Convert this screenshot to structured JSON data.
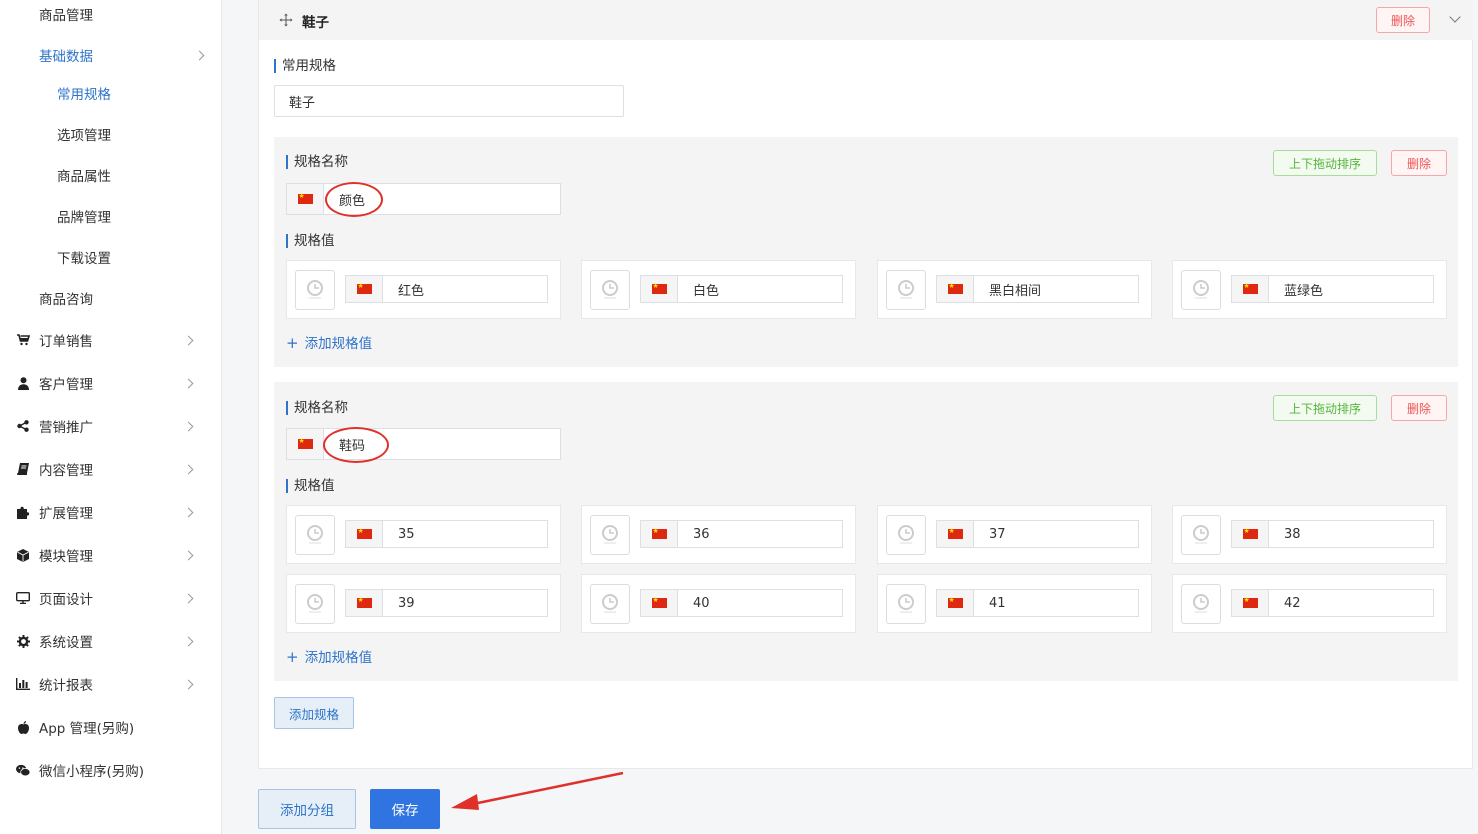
{
  "sidebar": {
    "items": [
      {
        "label": "商品管理",
        "level": "sub1",
        "icon": "",
        "chevron": false
      },
      {
        "label": "基础数据",
        "level": "sub1",
        "icon": "",
        "chevron": true,
        "state": "active-parent"
      },
      {
        "label": "常用规格",
        "level": "sub2",
        "icon": "",
        "chevron": false,
        "state": "active"
      },
      {
        "label": "选项管理",
        "level": "sub2",
        "icon": "",
        "chevron": false
      },
      {
        "label": "商品属性",
        "level": "sub2",
        "icon": "",
        "chevron": false
      },
      {
        "label": "品牌管理",
        "level": "sub2",
        "icon": "",
        "chevron": false
      },
      {
        "label": "下载设置",
        "level": "sub2",
        "icon": "",
        "chevron": false
      },
      {
        "label": "商品咨询",
        "level": "sub1",
        "icon": "",
        "chevron": false
      },
      {
        "label": "订单销售",
        "level": "top",
        "icon": "cart-icon",
        "chevron": true
      },
      {
        "label": "客户管理",
        "level": "top",
        "icon": "user-icon",
        "chevron": true
      },
      {
        "label": "营销推广",
        "level": "top",
        "icon": "share-icon",
        "chevron": true
      },
      {
        "label": "内容管理",
        "level": "top",
        "icon": "book-icon",
        "chevron": true
      },
      {
        "label": "扩展管理",
        "level": "top",
        "icon": "puzzle-icon",
        "chevron": true
      },
      {
        "label": "模块管理",
        "level": "top",
        "icon": "cube-icon",
        "chevron": true
      },
      {
        "label": "页面设计",
        "level": "top",
        "icon": "monitor-icon",
        "chevron": true
      },
      {
        "label": "系统设置",
        "level": "top",
        "icon": "gear-icon",
        "chevron": true
      },
      {
        "label": "统计报表",
        "level": "top",
        "icon": "bar-chart-icon",
        "chevron": true
      },
      {
        "label": "App 管理(另购)",
        "level": "top",
        "icon": "apple-icon",
        "chevron": false
      },
      {
        "label": "微信小程序(另购)",
        "level": "top",
        "icon": "wechat-icon",
        "chevron": false
      }
    ]
  },
  "group": {
    "title": "鞋子",
    "delete_label": "删除",
    "common_spec_label": "常用规格",
    "common_spec_value": "鞋子",
    "specs": [
      {
        "name_label": "规格名称",
        "name_value": "颜色",
        "values_label": "规格值",
        "sort_label": "上下拖动排序",
        "delete_label": "删除",
        "values": [
          "红色",
          "白色",
          "黑白相间",
          "蓝绿色"
        ],
        "add_value_label": "添加规格值"
      },
      {
        "name_label": "规格名称",
        "name_value": "鞋码",
        "values_label": "规格值",
        "sort_label": "上下拖动排序",
        "delete_label": "删除",
        "values": [
          "35",
          "36",
          "37",
          "38",
          "39",
          "40",
          "41",
          "42"
        ],
        "add_value_label": "添加规格值"
      }
    ],
    "add_spec_label": "添加规格"
  },
  "footer": {
    "add_group_label": "添加分组",
    "save_label": "保存"
  },
  "colors": {
    "accent": "#2f74c9",
    "save_bg": "#2f74e0",
    "danger": "#ee5555",
    "success": "#53b53a",
    "annotation": "#e0302a"
  }
}
